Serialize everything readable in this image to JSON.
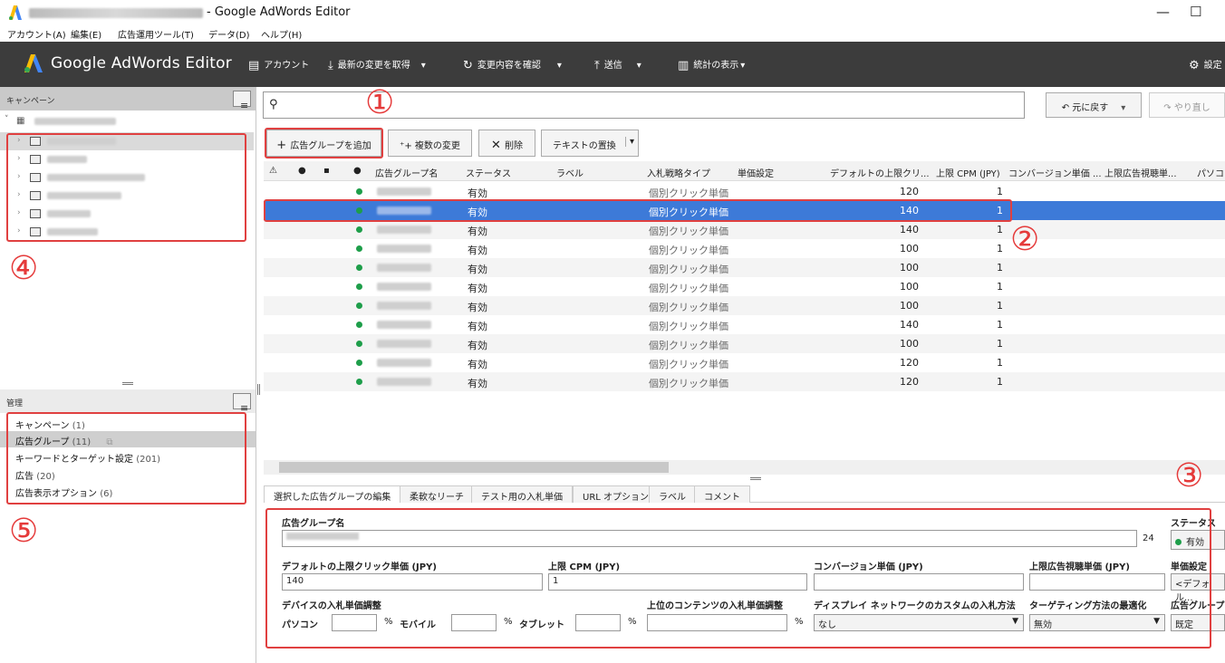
{
  "window": {
    "title": "- Google AdWords Editor",
    "minimize": "—",
    "maximize": "☐"
  },
  "menu": [
    "アカウント(A)",
    "編集(E)",
    "広告運用ツール(T)",
    "データ(D)",
    "ヘルプ(H)"
  ],
  "toolbar": {
    "brand": "Google AdWords Editor",
    "account": "アカウント",
    "get_changes": "最新の変更を取得",
    "review_changes": "変更内容を確認",
    "post": "送信",
    "stats": "統計の表示",
    "settings": "設定"
  },
  "left": {
    "campaign_header": "キャンペーン",
    "mgmt_header": "管理",
    "mgmt_items": [
      {
        "label": "キャンペーン",
        "count": "(1)"
      },
      {
        "label": "広告グループ",
        "count": "(11)"
      },
      {
        "label": "キーワードとターゲット設定",
        "count": "(201)"
      },
      {
        "label": "広告",
        "count": "(20)"
      },
      {
        "label": "広告表示オプション",
        "count": "(6)"
      }
    ]
  },
  "annotations": {
    "n1": "①",
    "n2": "②",
    "n3": "③",
    "n4": "④",
    "n5": "⑤"
  },
  "actions": {
    "undo": "元に戻す",
    "redo": "やり直し",
    "add_group": "広告グループを追加",
    "multi_change": "複数の変更",
    "delete": "削除",
    "replace_text": "テキストの置換"
  },
  "grid": {
    "headers": {
      "name": "広告グループ名",
      "status": "ステータス",
      "label": "ラベル",
      "bid_strategy": "入札戦略タイプ",
      "bid_setting": "単価設定",
      "default_cpc": "デフォルトの上限クリ...",
      "max_cpm": "上限 CPM (JPY)",
      "conv_cpa": "コンバージョン単価 ...",
      "max_cpv": "上限広告視聴単...",
      "pc": "パソコン"
    },
    "rows": [
      {
        "status": "有効",
        "bid": "個別クリック単価",
        "cpc": "120",
        "cpm": "1"
      },
      {
        "status": "有効",
        "bid": "個別クリック単価",
        "cpc": "140",
        "cpm": "1"
      },
      {
        "status": "有効",
        "bid": "個別クリック単価",
        "cpc": "140",
        "cpm": "1"
      },
      {
        "status": "有効",
        "bid": "個別クリック単価",
        "cpc": "100",
        "cpm": "1"
      },
      {
        "status": "有効",
        "bid": "個別クリック単価",
        "cpc": "100",
        "cpm": "1"
      },
      {
        "status": "有効",
        "bid": "個別クリック単価",
        "cpc": "100",
        "cpm": "1"
      },
      {
        "status": "有効",
        "bid": "個別クリック単価",
        "cpc": "100",
        "cpm": "1"
      },
      {
        "status": "有効",
        "bid": "個別クリック単価",
        "cpc": "140",
        "cpm": "1"
      },
      {
        "status": "有効",
        "bid": "個別クリック単価",
        "cpc": "100",
        "cpm": "1"
      },
      {
        "status": "有効",
        "bid": "個別クリック単価",
        "cpc": "120",
        "cpm": "1"
      },
      {
        "status": "有効",
        "bid": "個別クリック単価",
        "cpc": "120",
        "cpm": "1"
      }
    ]
  },
  "tabs": [
    "選択した広告グループの編集",
    "柔軟なリーチ",
    "テスト用の入札単価",
    "URL オプション",
    "ラベル",
    "コメント"
  ],
  "edit": {
    "group_name_label": "広告グループ名",
    "char_count": "24",
    "status_label": "ステータス",
    "status_value": "有効",
    "default_cpc_label": "デフォルトの上限クリック単価 (JPY)",
    "default_cpc_value": "140",
    "max_cpm_label": "上限 CPM (JPY)",
    "max_cpm_value": "1",
    "conv_cpa_label": "コンバージョン単価 (JPY)",
    "max_cpv_label": "上限広告視聴単価 (JPY)",
    "bid_setting_label": "単価設定",
    "bid_setting_value": "<デフォル...",
    "device_label": "デバイスの入札単価調整",
    "pc_label": "パソコン",
    "mobile_label": "モバイル",
    "tablet_label": "タブレット",
    "pct": "%",
    "content_label": "上位のコンテンツの入札単価調整",
    "display_label": "ディスプレイ ネットワークのカスタムの入札方法",
    "display_value": "なし",
    "targeting_label": "ターゲティング方法の最適化",
    "targeting_value": "無効",
    "group_type_label": "広告グループ",
    "group_type_value": "既定"
  },
  "colors": {
    "toolbar_bg": "#3c3c3c",
    "selected_row": "#3d7ad8",
    "annotation_red": "#e04040",
    "status_green": "#1e9e4a"
  }
}
